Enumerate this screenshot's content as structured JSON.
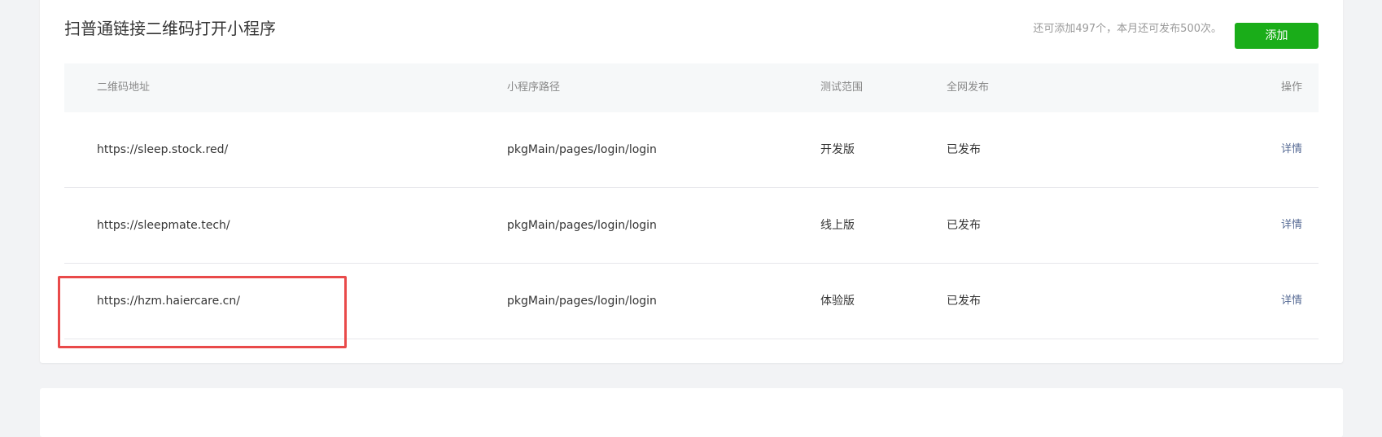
{
  "section": {
    "title": "扫普通链接二维码打开小程序",
    "quota_text": "还可添加497个，本月还可发布500次。",
    "add_label": "添加"
  },
  "table": {
    "headers": {
      "qr_address": "二维码地址",
      "path": "小程序路径",
      "test_scope": "测试范围",
      "publish": "全网发布",
      "action": "操作"
    },
    "rows": [
      {
        "qr_address": "https://sleep.stock.red/",
        "path": "pkgMain/pages/login/login",
        "test_scope": "开发版",
        "publish": "已发布",
        "action": "详情"
      },
      {
        "qr_address": "https://sleepmate.tech/",
        "path": "pkgMain/pages/login/login",
        "test_scope": "线上版",
        "publish": "已发布",
        "action": "详情"
      },
      {
        "qr_address": "https://hzm.haiercare.cn/",
        "path": "pkgMain/pages/login/login",
        "test_scope": "体验版",
        "publish": "已发布",
        "action": "详情"
      }
    ]
  },
  "colors": {
    "accent_green": "#1aad19",
    "link_blue": "#576b95",
    "highlight_red": "#e94a4a"
  }
}
